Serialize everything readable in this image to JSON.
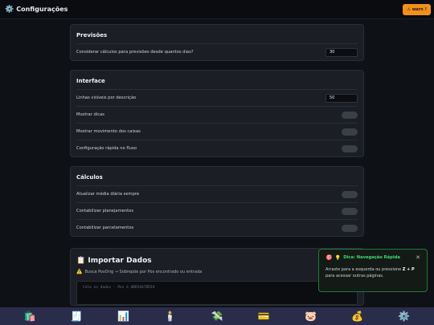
{
  "header": {
    "icon": "gear-icon",
    "title": "Configurações",
    "warn_button_icon": "warning-icon",
    "warn_button_label": "warn",
    "warn_button_badge": "!"
  },
  "previsoes": {
    "title": "Previsões",
    "forecast_days_label": "Considerar cálculos para previsões desde quantos dias?",
    "forecast_days_value": "30"
  },
  "interface": {
    "title": "Interface",
    "lines_label": "Linhas visíveis por descrição",
    "lines_value": "50",
    "show_tips_label": "Mostrar dicas",
    "show_cash_label": "Mostrar movimento dos caixas",
    "quick_config_label": "Configuração rápida no fluxo"
  },
  "calculos": {
    "title": "Cálculos",
    "update_avg_label": "Atualizar média diária sempre",
    "count_plans_label": "Contabilizar planejamentos",
    "count_installments_label": "Contabilizar parcelamentos"
  },
  "importar": {
    "icon": "clipboard-icon",
    "title": "Importar Dados",
    "note_icon": "warning-icon",
    "note": "Busca PosOrig → Sobrepõe por Pos encontrado ou entrada",
    "paste_placeholder": "Cole os dados - Pos é OBRIGATÓRIO"
  },
  "toast": {
    "title": "Dica: Navegação Rápida",
    "body_prefix": "Arraste para a esquerda ou pressione ",
    "shortcut": "Z + P",
    "body_suffix": " para acessar outras páginas.",
    "close": "✕"
  },
  "bottom_nav": {
    "items": [
      "shopping-bags-icon",
      "receipt-icon",
      "chart-icon",
      "candle-icon",
      "money-wings-icon",
      "credit-card-icon",
      "piggy-bank-icon",
      "money-bag-icon",
      "gear-icon"
    ]
  },
  "colors": {
    "accent_warn": "#f0901f",
    "toast_green": "#3ddc73",
    "nav_bg": "#2a2d4a",
    "card_bg": "#1b1e24"
  }
}
